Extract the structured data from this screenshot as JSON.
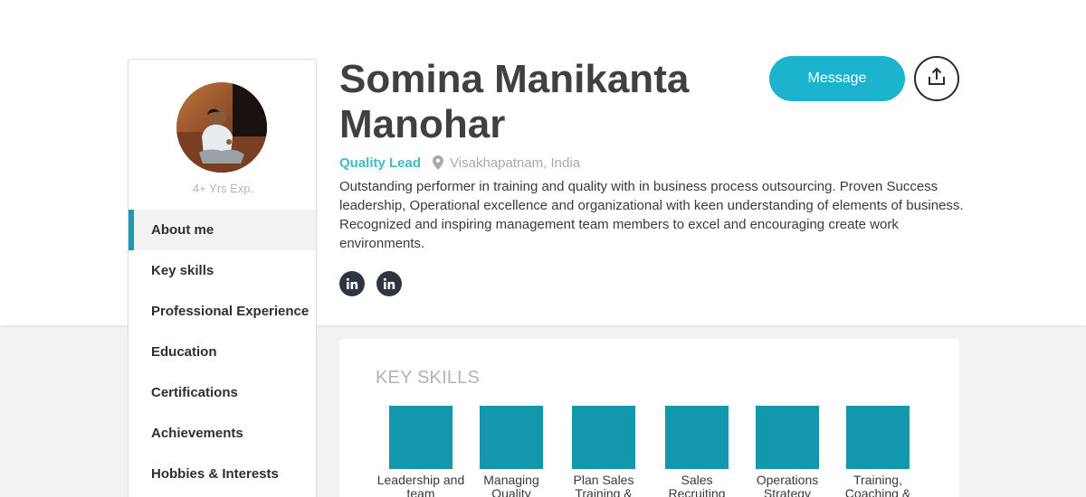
{
  "profile": {
    "experience": "4+ Yrs Exp.",
    "name_line1": "Somina Manikanta",
    "name_line2": "Manohar",
    "role": "Quality Lead",
    "location": "Visakhapatnam, India",
    "about": "Outstanding performer in training and quality with in business process outsourcing. Proven Success leadership, Operational excellence and organizational with keen understanding of elements of business. Recognized and inspiring management team members to excel and encouraging create work environments."
  },
  "actions": {
    "message_label": "Message",
    "share_icon": "share-icon"
  },
  "social": [
    {
      "icon": "linkedin-icon",
      "label": "in"
    },
    {
      "icon": "linkedin-icon",
      "label": "in"
    }
  ],
  "sidebar": {
    "items": [
      {
        "label": "About me",
        "active": true
      },
      {
        "label": "Key skills"
      },
      {
        "label": "Professional Experience"
      },
      {
        "label": "Education"
      },
      {
        "label": "Certifications"
      },
      {
        "label": "Achievements"
      },
      {
        "label": "Hobbies & Interests"
      }
    ]
  },
  "skills": {
    "title": "KEY SKILLS",
    "items": [
      {
        "label": "Leadership and team"
      },
      {
        "label": "Managing Quality"
      },
      {
        "label": "Plan Sales Training &"
      },
      {
        "label": "Sales Recruiting"
      },
      {
        "label": "Operations Strategy"
      },
      {
        "label": "Training, Coaching &"
      }
    ]
  },
  "colors": {
    "accent": "#1cb3cf",
    "skill_tile": "#1297ad",
    "role": "#45b8c7",
    "social": "#2e3440"
  }
}
